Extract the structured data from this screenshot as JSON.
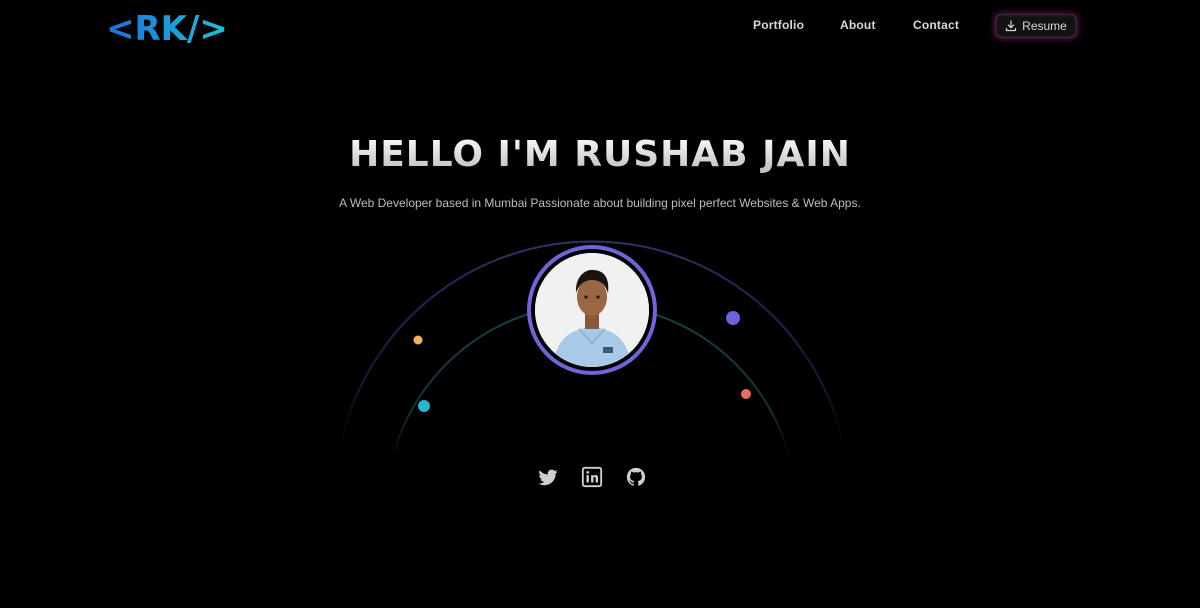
{
  "logo": {
    "text": "<RK/>",
    "gradient_start": "#1e6fe0",
    "gradient_end": "#19c3d6"
  },
  "nav": {
    "links": [
      {
        "label": "Portfolio"
      },
      {
        "label": "About"
      },
      {
        "label": "Contact"
      }
    ],
    "resume": {
      "label": "Resume",
      "icon": "download-icon"
    }
  },
  "hero": {
    "title": "HELLO I'M RUSHAB JAIN",
    "tagline": "A Web Developer based in Mumbai Passionate about building pixel perfect Websites & Web Apps.",
    "avatar_ring_color": "#6f65d8"
  },
  "orbit_dots": [
    {
      "name": "orange",
      "color": "#f3b25b"
    },
    {
      "name": "teal",
      "color": "#25b6cf"
    },
    {
      "name": "purple",
      "color": "#6b63dd"
    },
    {
      "name": "red",
      "color": "#ec6a5e"
    }
  ],
  "socials": [
    {
      "name": "twitter-icon"
    },
    {
      "name": "linkedin-icon"
    },
    {
      "name": "github-icon"
    }
  ],
  "colors": {
    "background": "#000000",
    "accent_glow": "#dc28a0"
  }
}
